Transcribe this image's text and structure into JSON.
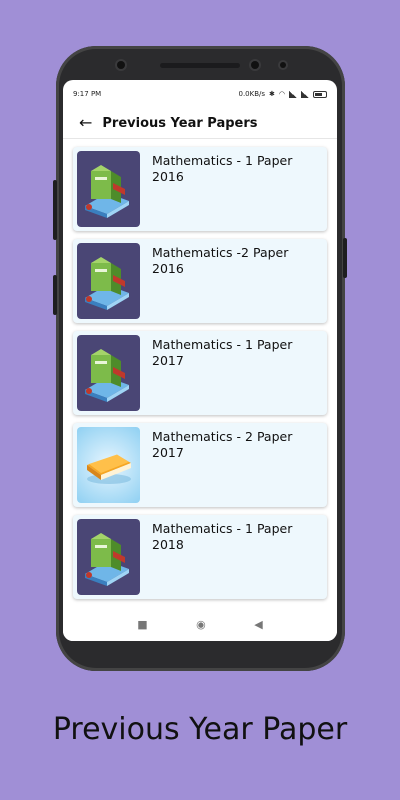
{
  "status_bar": {
    "time": "9:17 PM",
    "net_speed": "0.0KB/s",
    "battery": "37"
  },
  "app_bar": {
    "title": "Previous Year Papers"
  },
  "papers": [
    {
      "label": "Mathematics - 1 Paper 2016",
      "thumbnail": "book-stack-icon"
    },
    {
      "label": "Mathematics -2 Paper 2016",
      "thumbnail": "book-stack-icon"
    },
    {
      "label": "Mathematics - 1 Paper 2017",
      "thumbnail": "book-stack-icon"
    },
    {
      "label": "Mathematics - 2 Paper 2017",
      "thumbnail": "orange-book-icon"
    },
    {
      "label": "Mathematics - 1 Paper 2018",
      "thumbnail": "book-stack-icon"
    }
  ],
  "nav_bar": {
    "recents_icon": "square-icon",
    "home_icon": "circle-icon",
    "back_icon": "triangle-back-icon"
  },
  "caption": "Previous Year Paper",
  "colors": {
    "background": "#a08fd6",
    "card_background": "#eef8fd",
    "thumb_dark": "#4a4675"
  }
}
